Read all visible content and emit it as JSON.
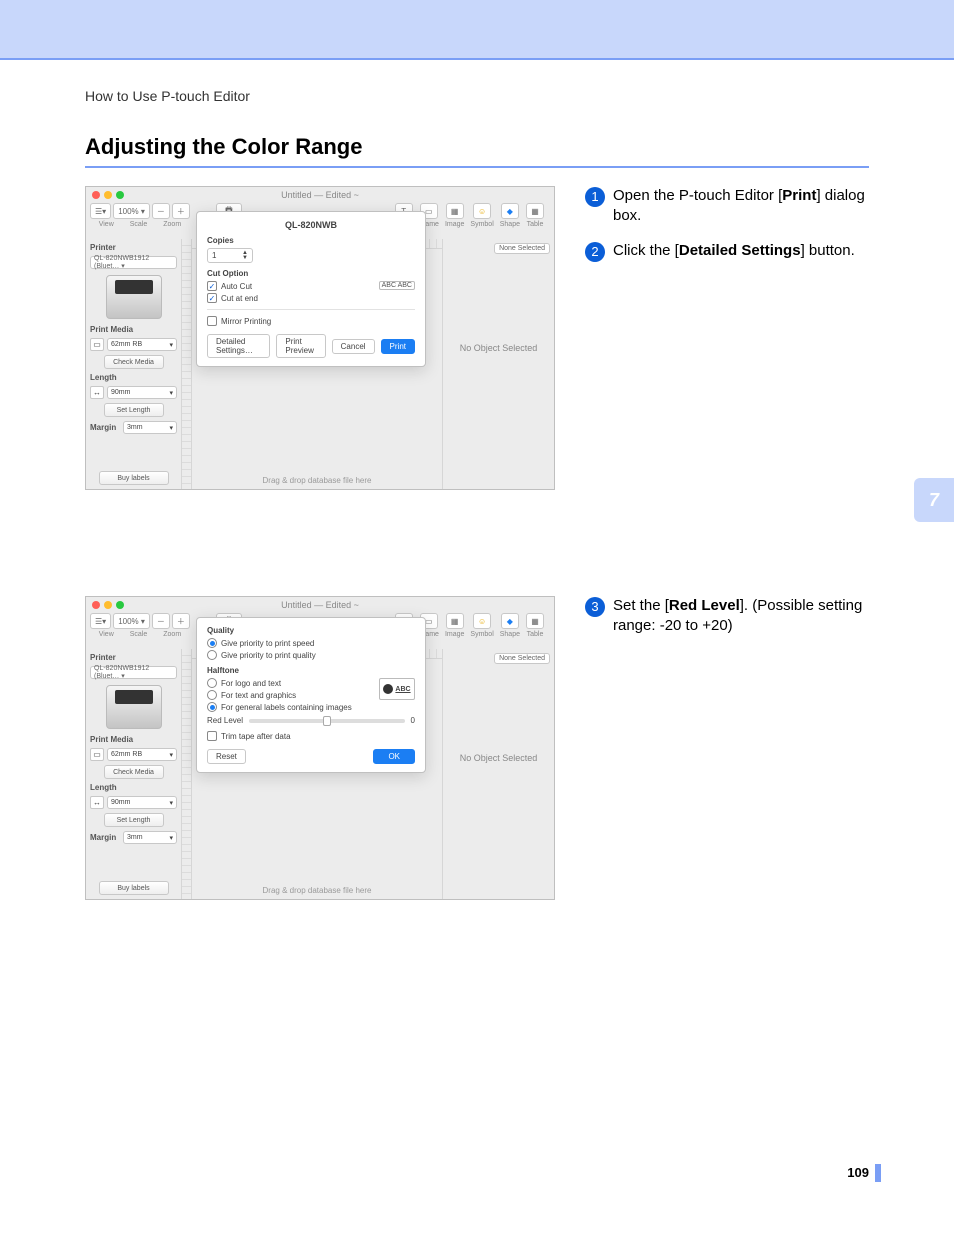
{
  "header": {
    "breadcrumb": "How to Use P-touch Editor"
  },
  "title": "Adjusting the Color Range",
  "chapter_tab": "7",
  "page_number": "109",
  "steps": {
    "s1": {
      "num": "1",
      "pre": "Open the P-touch Editor [",
      "bold": "Print",
      "post": "] dialog box."
    },
    "s2": {
      "num": "2",
      "pre": "Click the [",
      "bold": "Detailed Settings",
      "post": "] button."
    },
    "s3": {
      "num": "3",
      "pre": "Set the [",
      "bold": "Red Level",
      "post": "]. (Possible setting range:  -20 to +20)"
    }
  },
  "window": {
    "title": "Untitled — Edited ~",
    "zoom": "100% ▾",
    "tb_labels": {
      "view": "View",
      "scale": "Scale",
      "zoom": "Zoom",
      "print": "Print",
      "text": "Text",
      "frame": "Frame",
      "image": "Image",
      "symbol": "Symbol",
      "shape": "Shape",
      "table": "Table"
    },
    "left": {
      "printer": "Printer",
      "printer_select": "QL-820NWB1912 (Bluet… ▾",
      "print_media": "Print Media",
      "media_value": "62mm RB",
      "check_media": "Check Media",
      "length": "Length",
      "length_value": "90mm",
      "set_length": "Set Length",
      "margin": "Margin",
      "margin_value": "3mm",
      "buy_labels": "Buy labels"
    },
    "right": {
      "none_selected": "None Selected",
      "no_object": "No Object Selected"
    },
    "drop_hint": "Drag & drop database file here"
  },
  "dlg1": {
    "title": "QL-820NWB",
    "copies": "Copies",
    "copies_value": "1",
    "cut_option": "Cut Option",
    "auto_cut": "Auto Cut",
    "cut_at_end": "Cut at end",
    "chip": "ABC  ABC",
    "mirror": "Mirror Printing",
    "detailed": "Detailed Settings…",
    "preview": "Print Preview",
    "cancel": "Cancel",
    "print": "Print"
  },
  "dlg2": {
    "quality": "Quality",
    "q_speed": "Give priority to print speed",
    "q_quality": "Give priority to print quality",
    "halftone": "Halftone",
    "ht_logo": "For logo and text",
    "ht_text": "For text and graphics",
    "ht_general": "For general labels containing images",
    "ht_abc": "ABC",
    "red_level": "Red Level",
    "red_value": "0",
    "trim": "Trim tape after data",
    "reset": "Reset",
    "ok": "OK"
  }
}
